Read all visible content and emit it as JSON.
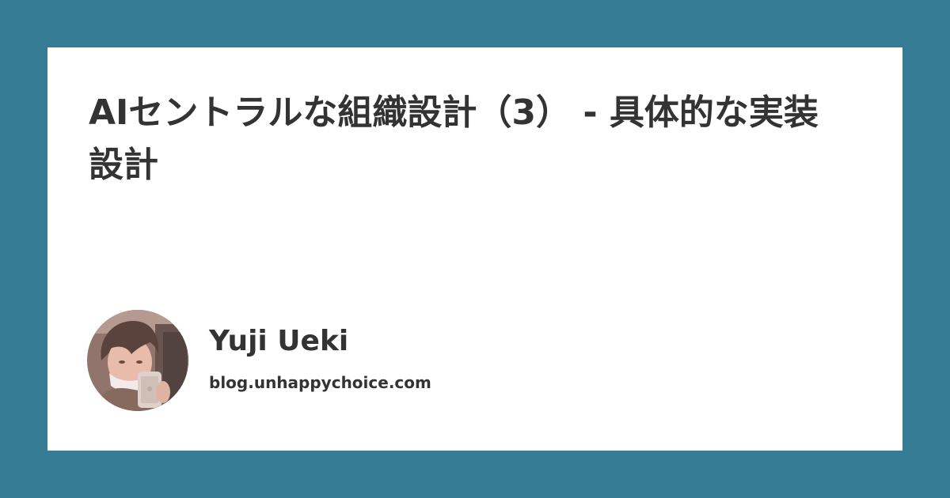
{
  "post": {
    "title": "AIセントラルな組織設計（3） - 具体的な実装設計"
  },
  "author": {
    "name": "Yuji Ueki",
    "site": "blog.unhappychoice.com"
  },
  "colors": {
    "background": "#367c94",
    "card": "#ffffff",
    "text": "#333333"
  }
}
